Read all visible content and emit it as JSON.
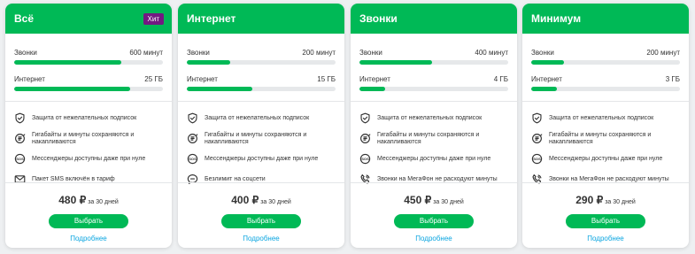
{
  "colors": {
    "accent": "#00b956",
    "badge": "#731982",
    "link": "#0aa5e0"
  },
  "labels": {
    "calls": "Звонки",
    "internet": "Интернет",
    "button": "Выбрать",
    "more": "Подробнее",
    "period": "за 30 дней"
  },
  "cards": [
    {
      "title": "Всё",
      "badge": "Хит",
      "calls": "600 минут",
      "calls_level": 0.72,
      "internet": "25 ГБ",
      "internet_level": 0.78,
      "features": [
        {
          "icon": "shield-icon",
          "text": "Защита от нежелательных подписок"
        },
        {
          "icon": "rollover-icon",
          "text": "Гигабайты и минуты сохраняются и накапливаются"
        },
        {
          "icon": "sos-icon",
          "text": "Мессенджеры доступны даже при нуле"
        },
        {
          "icon": "envelope-icon",
          "text": "Пакет SMS включён в тариф"
        }
      ],
      "price": "480 ₽"
    },
    {
      "title": "Интернет",
      "badge": "",
      "calls": "200 минут",
      "calls_level": 0.29,
      "internet": "15 ГБ",
      "internet_level": 0.44,
      "features": [
        {
          "icon": "shield-icon",
          "text": "Защита от нежелательных подписок"
        },
        {
          "icon": "rollover-icon",
          "text": "Гигабайты и минуты сохраняются и накапливаются"
        },
        {
          "icon": "sos-icon",
          "text": "Мессенджеры доступны даже при нуле"
        },
        {
          "icon": "chat-icon",
          "text": "Безлимит на соцсети"
        }
      ],
      "price": "400 ₽"
    },
    {
      "title": "Звонки",
      "badge": "",
      "calls": "400 минут",
      "calls_level": 0.49,
      "internet": "4 ГБ",
      "internet_level": 0.17,
      "features": [
        {
          "icon": "shield-icon",
          "text": "Защита от нежелательных подписок"
        },
        {
          "icon": "rollover-icon",
          "text": "Гигабайты и минуты сохраняются и накапливаются"
        },
        {
          "icon": "sos-icon",
          "text": "Мессенджеры доступны даже при нуле"
        },
        {
          "icon": "phone-icon",
          "text": "Звонки на МегаФон не расходуют минуты"
        }
      ],
      "price": "450 ₽"
    },
    {
      "title": "Минимум",
      "badge": "",
      "calls": "200 минут",
      "calls_level": 0.22,
      "internet": "3 ГБ",
      "internet_level": 0.17,
      "features": [
        {
          "icon": "shield-icon",
          "text": "Защита от нежелательных подписок"
        },
        {
          "icon": "rollover-icon",
          "text": "Гигабайты и минуты сохраняются и накапливаются"
        },
        {
          "icon": "sos-icon",
          "text": "Мессенджеры доступны даже при нуле"
        },
        {
          "icon": "phone-icon",
          "text": "Звонки на МегаФон не расходуют минуты"
        }
      ],
      "price": "290 ₽"
    }
  ]
}
